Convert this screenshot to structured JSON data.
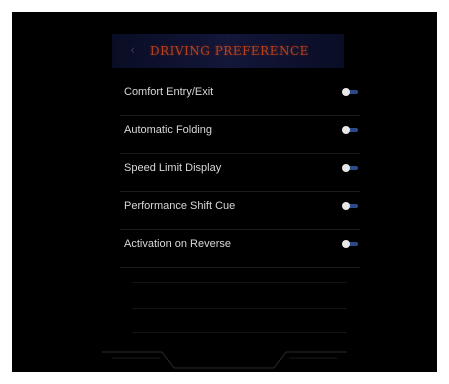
{
  "header": {
    "back_icon": "chevron-left-icon",
    "title": "DRIVING PREFERENCE"
  },
  "menu": {
    "items": [
      {
        "label": "Comfort Entry/Exit",
        "enabled": true
      },
      {
        "label": "Automatic Folding",
        "enabled": true
      },
      {
        "label": "Speed Limit Display",
        "enabled": true
      },
      {
        "label": "Performance Shift Cue",
        "enabled": true
      },
      {
        "label": "Activation on Reverse",
        "enabled": true
      }
    ]
  },
  "colors": {
    "background": "#000000",
    "title": "#b8401c",
    "item_text": "#d8d8d8",
    "toggle_knob": "#e8e8e8",
    "toggle_track": "#2a4a8a"
  }
}
